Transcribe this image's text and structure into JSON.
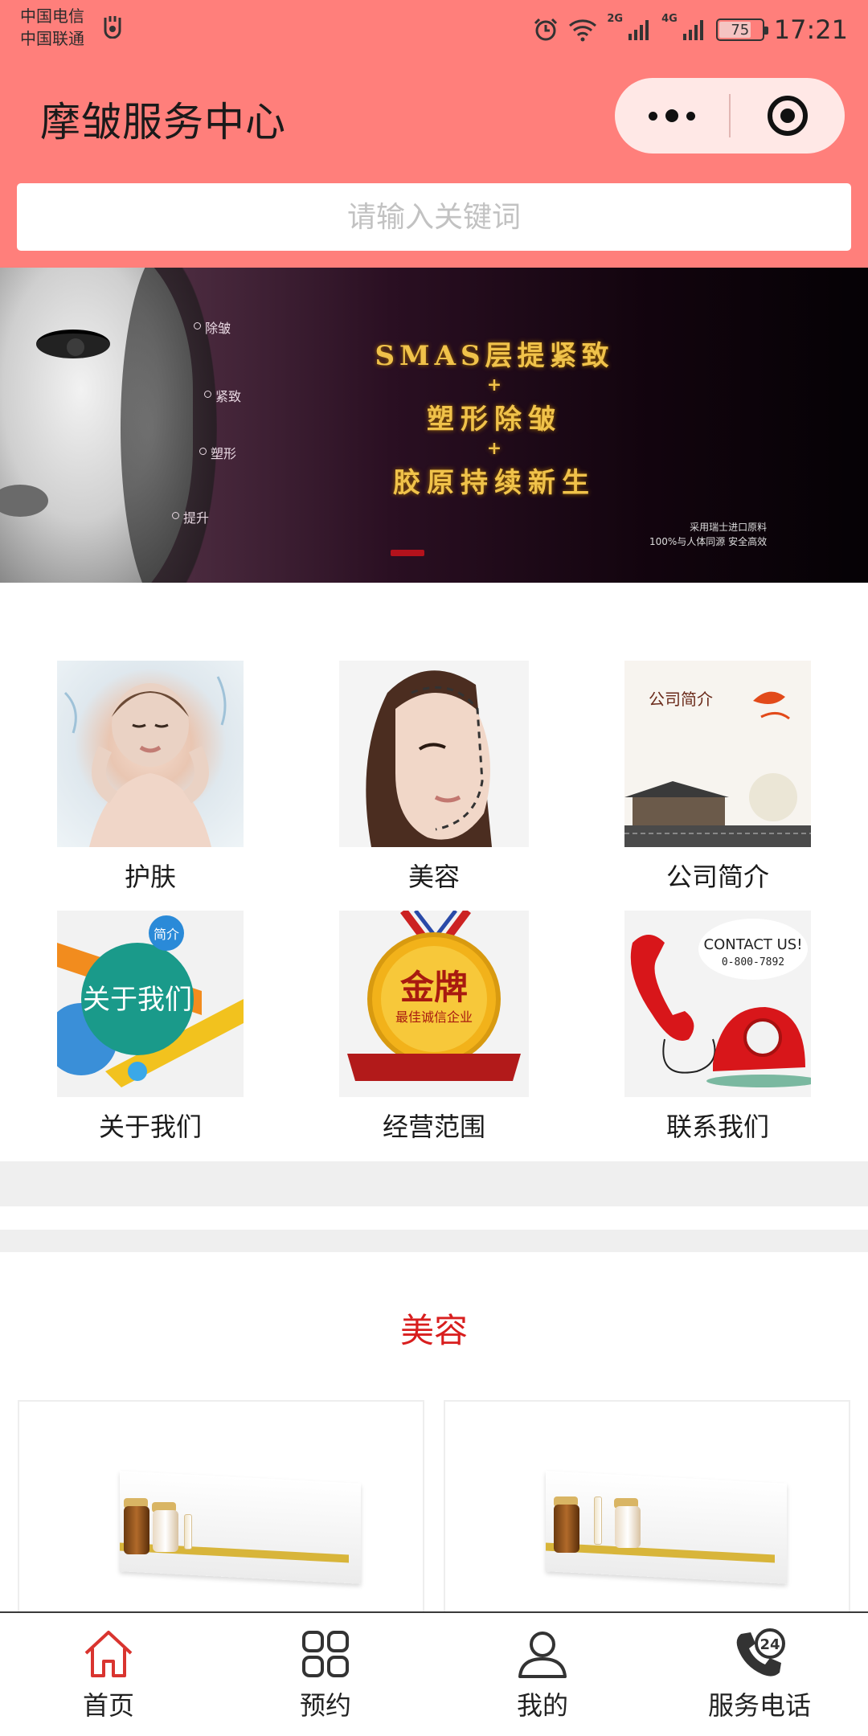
{
  "status_bar": {
    "carrier_1": "中国电信",
    "carrier_2": "中国联通",
    "net_2g": "2G",
    "net_4g": "4G",
    "battery": "75",
    "battery_level": 0.75,
    "time": "17:21"
  },
  "header": {
    "title": "摩皱服务中心",
    "background_color": "#ff7f7b"
  },
  "search": {
    "placeholder": "请输入关键词"
  },
  "banner": {
    "hints": [
      "除皱",
      "紧致",
      "塑形",
      "提升"
    ],
    "headline_1": "SMAS层提紧致",
    "plus": "+",
    "headline_2": "塑形除皱",
    "headline_3": "胶原持续新生",
    "fine_1": "采用瑞士进口原料",
    "fine_2": "100%与人体同源  安全高效"
  },
  "categories": [
    {
      "label": "护肤",
      "icon": "skin-care-image"
    },
    {
      "label": "美容",
      "icon": "beauty-image"
    },
    {
      "label": "公司简介",
      "icon": "company-intro-image",
      "image_text": "公司简介"
    },
    {
      "label": "关于我们",
      "icon": "about-us-image",
      "image_text": "关于我们",
      "badge": "简介"
    },
    {
      "label": "经营范围",
      "icon": "business-scope-image",
      "image_text": "金牌",
      "sub_text": "最佳诚信企业"
    },
    {
      "label": "联系我们",
      "icon": "contact-us-image",
      "image_text": "CONTACT US!",
      "sub_text": "0-800-7892"
    }
  ],
  "section": {
    "title": "美容",
    "title_color": "#d81e1e"
  },
  "tabbar": [
    {
      "label": "首页",
      "icon": "home-icon",
      "active": true
    },
    {
      "label": "预约",
      "icon": "grid-icon",
      "active": false
    },
    {
      "label": "我的",
      "icon": "user-icon",
      "active": false
    },
    {
      "label": "服务电话",
      "icon": "phone-24-icon",
      "active": false
    }
  ],
  "colors": {
    "accent": "#d81e1e",
    "tab_active": "#d9342f"
  }
}
